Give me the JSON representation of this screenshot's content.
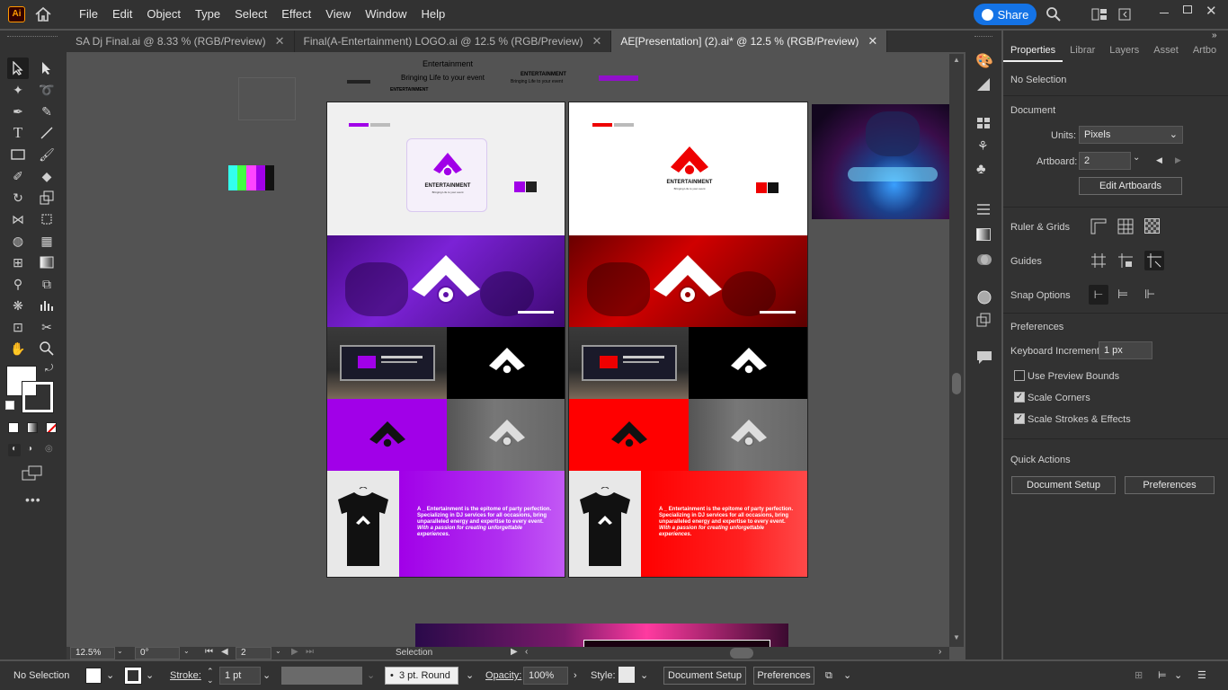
{
  "app": {
    "logo": "Ai",
    "share_label": "Share"
  },
  "menu": [
    "File",
    "Edit",
    "Object",
    "Type",
    "Select",
    "Effect",
    "View",
    "Window",
    "Help"
  ],
  "tabs": [
    {
      "label": "SA Dj Final.ai @ 8.33 % (RGB/Preview)"
    },
    {
      "label": "Final(A-Entertainment) LOGO.ai @ 12.5 % (RGB/Preview)"
    },
    {
      "label": "AE[Presentation] (2).ai* @ 12.5 % (RGB/Preview)"
    }
  ],
  "canvas": {
    "top_texts": {
      "entertainment": "Entertainment",
      "tagline": "Bringing Life to your event",
      "entertainment_caps": "ENTERTAINMENT",
      "tagline2": "Bringing Life to your event"
    },
    "brand": "ENTERTAINMENT",
    "brand_tag": "Bringing Life to your event",
    "body_text": "A _ Entertainment is the epitome of party perfection. Specializing in DJ services for all occasions, bring unparalleled energy and expertise to every event.",
    "body_italic": "With a passion for creating unforgettable experiences."
  },
  "status": {
    "zoom": "12.5%",
    "rotate": "0°",
    "artboard": "2",
    "tool": "Selection"
  },
  "properties": {
    "tabs": [
      "Properties",
      "Librar",
      "Layers",
      "Asset",
      "Artbo"
    ],
    "selection": "No Selection",
    "document_title": "Document",
    "units_label": "Units:",
    "units_value": "Pixels",
    "artboard_label": "Artboard:",
    "artboard_value": "2",
    "edit_artboards": "Edit Artboards",
    "ruler_grids": "Ruler & Grids",
    "guides": "Guides",
    "snap_options": "Snap Options",
    "preferences_title": "Preferences",
    "keyboard_increment_label": "Keyboard Increment:",
    "keyboard_increment_value": "1 px",
    "use_preview_bounds": "Use Preview Bounds",
    "scale_corners": "Scale Corners",
    "scale_strokes": "Scale Strokes & Effects",
    "quick_actions": "Quick Actions",
    "document_setup": "Document Setup",
    "preferences_btn": "Preferences"
  },
  "control": {
    "selection": "No Selection",
    "stroke_label": "Stroke:",
    "stroke_value": "1 pt",
    "brush": "3 pt. Round",
    "opacity_label": "Opacity:",
    "opacity_value": "100%",
    "style_label": "Style:",
    "document_setup": "Document Setup",
    "preferences": "Preferences"
  },
  "colors": {
    "accent": "#1473e6",
    "purple": "#a100e8",
    "red": "#ff0000",
    "ai_orange": "#ff9a00"
  }
}
